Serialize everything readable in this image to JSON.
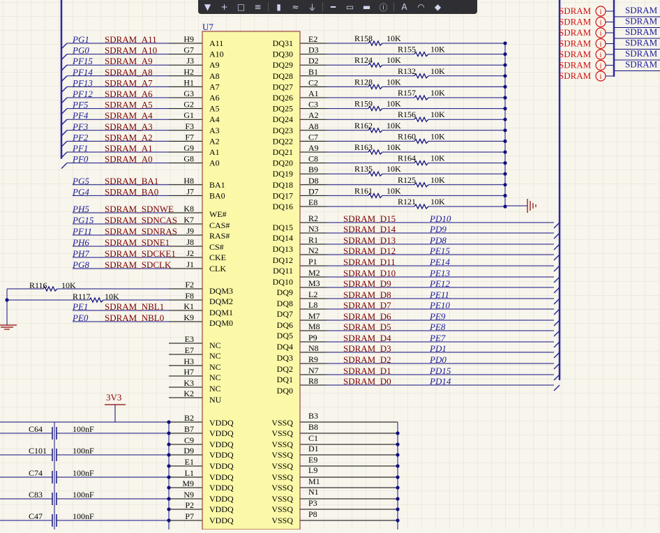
{
  "colors": {
    "background": "#f7f5ec",
    "grid": "#e3e0d3",
    "wire": "#101080",
    "bus": "#2a2a9a",
    "pin": "#000000",
    "netname": "#7a0000",
    "port": "#1a1a9a",
    "designator": "#1010a0",
    "body_fill": "#fbf8a8",
    "body_stroke": "#8a2020",
    "power": "#8a0000",
    "offsheet": "#d01010"
  },
  "toolbar": {
    "icons": [
      "filter-icon",
      "crosshair-icon",
      "select-rect-icon",
      "align-icon",
      "component-icon",
      "wire-icon",
      "ground-icon",
      "bus-icon",
      "net-label-icon",
      "sheet-entry-icon",
      "no-erc-icon",
      "text-icon",
      "arc-icon",
      "power-port-icon"
    ],
    "glyphs": [
      "▼",
      "+",
      "□",
      "≡",
      "▮",
      "≈",
      "⏚",
      "━",
      "▭",
      "▬",
      "ⓘ",
      "A",
      "◠",
      "◆"
    ]
  },
  "chip": {
    "designator": "U7"
  },
  "power": {
    "supply_label": "3V3"
  },
  "left_addr": [
    {
      "port": "PG1",
      "net": "SDRAM_A11",
      "pin": "H9",
      "name": "A11"
    },
    {
      "port": "PG0",
      "net": "SDRAM_A10",
      "pin": "G7",
      "name": "A10"
    },
    {
      "port": "PF15",
      "net": "SDRAM_A9",
      "pin": "J3",
      "name": "A9"
    },
    {
      "port": "PF14",
      "net": "SDRAM_A8",
      "pin": "H2",
      "name": "A8"
    },
    {
      "port": "PF13",
      "net": "SDRAM_A7",
      "pin": "H1",
      "name": "A7"
    },
    {
      "port": "PF12",
      "net": "SDRAM_A6",
      "pin": "G3",
      "name": "A6"
    },
    {
      "port": "PF5",
      "net": "SDRAM_A5",
      "pin": "G2",
      "name": "A5"
    },
    {
      "port": "PF4",
      "net": "SDRAM_A4",
      "pin": "G1",
      "name": "A4"
    },
    {
      "port": "PF3",
      "net": "SDRAM_A3",
      "pin": "F3",
      "name": "A3"
    },
    {
      "port": "PF2",
      "net": "SDRAM_A2",
      "pin": "F7",
      "name": "A2"
    },
    {
      "port": "PF1",
      "net": "SDRAM_A1",
      "pin": "G9",
      "name": "A1"
    },
    {
      "port": "PF0",
      "net": "SDRAM_A0",
      "pin": "G8",
      "name": "A0"
    }
  ],
  "left_ba": [
    {
      "port": "PG5",
      "net": "SDRAM_BA1",
      "pin": "H8",
      "name": "BA1"
    },
    {
      "port": "PG4",
      "net": "SDRAM_BA0",
      "pin": "J7",
      "name": "BA0"
    }
  ],
  "left_ctrl": [
    {
      "port": "PH5",
      "net": "SDRAM_SDNWE",
      "pin": "K8",
      "name": "WE#"
    },
    {
      "port": "PG15",
      "net": "SDRAM_SDNCAS",
      "pin": "K7",
      "name": "CAS#"
    },
    {
      "port": "PF11",
      "net": "SDRAM_SDNRAS",
      "pin": "J9",
      "name": "RAS#"
    },
    {
      "port": "PH6",
      "net": "SDRAM_SDNE1",
      "pin": "J8",
      "name": "CS#"
    },
    {
      "port": "PH7",
      "net": "SDRAM_SDCKE1",
      "pin": "J2",
      "name": "CKE"
    },
    {
      "port": "PG8",
      "net": "SDRAM_SDCLK",
      "pin": "J1",
      "name": "CLK"
    }
  ],
  "left_dqm": [
    {
      "port": "",
      "net": "",
      "pin": "F2",
      "name": "DQM3",
      "res": "R116",
      "val": "10K"
    },
    {
      "port": "",
      "net": "",
      "pin": "F8",
      "name": "DQM2",
      "res": "R117",
      "val": "10K"
    },
    {
      "port": "PE1",
      "net": "SDRAM_NBL1",
      "pin": "K1",
      "name": "DQM1"
    },
    {
      "port": "PE0",
      "net": "SDRAM_NBL0",
      "pin": "K9",
      "name": "DQM0"
    }
  ],
  "left_nc": [
    {
      "pin": "E3",
      "name": "NC"
    },
    {
      "pin": "E7",
      "name": "NC"
    },
    {
      "pin": "H3",
      "name": "NC"
    },
    {
      "pin": "H7",
      "name": "NC"
    },
    {
      "pin": "K3",
      "name": "NC"
    },
    {
      "pin": "K2",
      "name": "NU"
    }
  ],
  "left_vdd": [
    {
      "pin": "B2",
      "name": "VDDQ",
      "cap": "",
      "cval": ""
    },
    {
      "pin": "B7",
      "name": "VDDQ",
      "cap": "C64",
      "cval": "100nF"
    },
    {
      "pin": "C9",
      "name": "VDDQ",
      "cap": "",
      "cval": ""
    },
    {
      "pin": "D9",
      "name": "VDDQ",
      "cap": "C101",
      "cval": "100nF"
    },
    {
      "pin": "E1",
      "name": "VDDQ",
      "cap": "",
      "cval": ""
    },
    {
      "pin": "L1",
      "name": "VDDQ",
      "cap": "C74",
      "cval": "100nF"
    },
    {
      "pin": "M9",
      "name": "VDDQ",
      "cap": "",
      "cval": ""
    },
    {
      "pin": "N9",
      "name": "VDDQ",
      "cap": "C83",
      "cval": "100nF"
    },
    {
      "pin": "P2",
      "name": "VDDQ",
      "cap": "",
      "cval": ""
    },
    {
      "pin": "P7",
      "name": "VDDQ",
      "cap": "C47",
      "cval": "100nF"
    }
  ],
  "right_dq_high": [
    {
      "name": "DQ31",
      "pin": "E2",
      "res": "R158",
      "val": "10K"
    },
    {
      "name": "DQ30",
      "pin": "D3",
      "res": "R155",
      "val": "10K"
    },
    {
      "name": "DQ29",
      "pin": "D2",
      "res": "R124",
      "val": "10K"
    },
    {
      "name": "DQ28",
      "pin": "B1",
      "res": "R132",
      "val": "10K"
    },
    {
      "name": "DQ27",
      "pin": "C2",
      "res": "R128",
      "val": "10K"
    },
    {
      "name": "DQ26",
      "pin": "A1",
      "res": "R157",
      "val": "10K"
    },
    {
      "name": "DQ25",
      "pin": "C3",
      "res": "R159",
      "val": "10K"
    },
    {
      "name": "DQ24",
      "pin": "A2",
      "res": "R156",
      "val": "10K"
    },
    {
      "name": "DQ23",
      "pin": "A8",
      "res": "R162",
      "val": "10K"
    },
    {
      "name": "DQ22",
      "pin": "C7",
      "res": "R160",
      "val": "10K"
    },
    {
      "name": "DQ21",
      "pin": "A9",
      "res": "R163",
      "val": "10K"
    },
    {
      "name": "DQ20",
      "pin": "C8",
      "res": "R164",
      "val": "10K"
    },
    {
      "name": "DQ19",
      "pin": "B9",
      "res": "R135",
      "val": "10K"
    },
    {
      "name": "DQ18",
      "pin": "D8",
      "res": "R125",
      "val": "10K"
    },
    {
      "name": "DQ17",
      "pin": "D7",
      "res": "R161",
      "val": "10K"
    },
    {
      "name": "DQ16",
      "pin": "E8",
      "res": "R121",
      "val": "10K"
    }
  ],
  "right_dq_low": [
    {
      "name": "DQ15",
      "pin": "R2",
      "net": "SDRAM_D15",
      "port": "PD10"
    },
    {
      "name": "DQ14",
      "pin": "N3",
      "net": "SDRAM_D14",
      "port": "PD9"
    },
    {
      "name": "DQ13",
      "pin": "R1",
      "net": "SDRAM_D13",
      "port": "PD8"
    },
    {
      "name": "DQ12",
      "pin": "N2",
      "net": "SDRAM_D12",
      "port": "PE15"
    },
    {
      "name": "DQ11",
      "pin": "P1",
      "net": "SDRAM_D11",
      "port": "PE14"
    },
    {
      "name": "DQ10",
      "pin": "M2",
      "net": "SDRAM_D10",
      "port": "PE13"
    },
    {
      "name": "DQ9",
      "pin": "M3",
      "net": "SDRAM_D9",
      "port": "PE12"
    },
    {
      "name": "DQ8",
      "pin": "L2",
      "net": "SDRAM_D8",
      "port": "PE11"
    },
    {
      "name": "DQ7",
      "pin": "L8",
      "net": "SDRAM_D7",
      "port": "PE10"
    },
    {
      "name": "DQ6",
      "pin": "M7",
      "net": "SDRAM_D6",
      "port": "PE9"
    },
    {
      "name": "DQ5",
      "pin": "M8",
      "net": "SDRAM_D5",
      "port": "PE8"
    },
    {
      "name": "DQ4",
      "pin": "P9",
      "net": "SDRAM_D4",
      "port": "PE7"
    },
    {
      "name": "DQ3",
      "pin": "N8",
      "net": "SDRAM_D3",
      "port": "PD1"
    },
    {
      "name": "DQ2",
      "pin": "R9",
      "net": "SDRAM_D2",
      "port": "PD0"
    },
    {
      "name": "DQ1",
      "pin": "N7",
      "net": "SDRAM_D1",
      "port": "PD15"
    },
    {
      "name": "DQ0",
      "pin": "R8",
      "net": "SDRAM_D0",
      "port": "PD14"
    }
  ],
  "right_vss": [
    {
      "pin": "B3",
      "name": "VSSQ"
    },
    {
      "pin": "B8",
      "name": "VSSQ"
    },
    {
      "pin": "C1",
      "name": "VSSQ"
    },
    {
      "pin": "D1",
      "name": "VSSQ"
    },
    {
      "pin": "E9",
      "name": "VSSQ"
    },
    {
      "pin": "L9",
      "name": "VSSQ"
    },
    {
      "pin": "M1",
      "name": "VSSQ"
    },
    {
      "pin": "N1",
      "name": "VSSQ"
    },
    {
      "pin": "P3",
      "name": "VSSQ"
    },
    {
      "pin": "P8",
      "name": "VSSQ"
    }
  ],
  "offsheet_ports": [
    {
      "label": "SDRAM",
      "sym": "i",
      "right": "SDRAM"
    },
    {
      "label": "SDRAM",
      "sym": "i",
      "right": "SDRAM"
    },
    {
      "label": "SDRAM",
      "sym": "i",
      "right": "SDRAM"
    },
    {
      "label": "SDRAM",
      "sym": "i",
      "right": "SDRAM"
    },
    {
      "label": "SDRAM",
      "sym": "i",
      "right": "SDRAM"
    },
    {
      "label": "SDRAM",
      "sym": "i",
      "right": "SDRAM"
    },
    {
      "label": "SDRAM",
      "sym": "i",
      "right": ""
    }
  ]
}
